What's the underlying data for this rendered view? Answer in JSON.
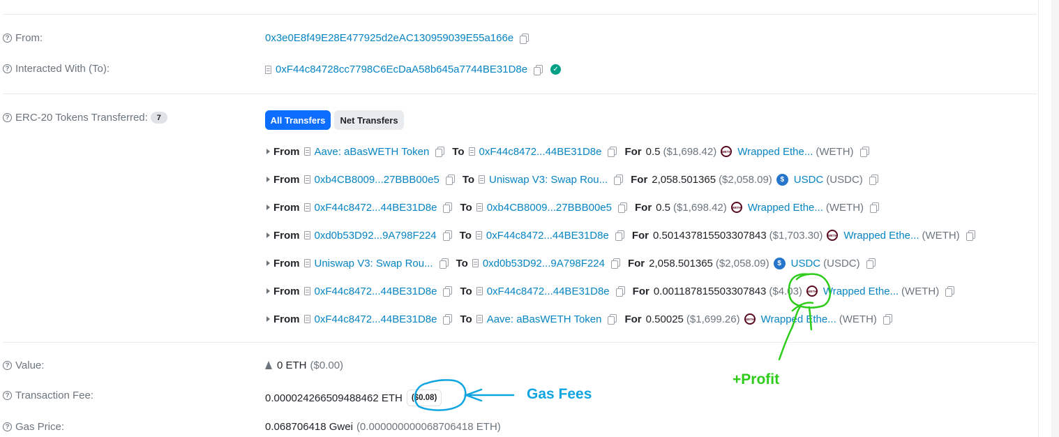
{
  "from": {
    "label": "From:",
    "address": "0x3e0E8f49E28E477925d2eAC130959039E55a166e"
  },
  "interacted": {
    "label": "Interacted With (To):",
    "address": "0xF44c84728cc7798C6EcDaA58b645a7744BE31D8e"
  },
  "erc20": {
    "label": "ERC-20 Tokens Transferred:",
    "count": "7",
    "tabs": {
      "all": "All Transfers",
      "net": "Net Transfers"
    },
    "rows": [
      {
        "from": "Aave: aBasWETH Token",
        "to": "0xF44c8472...44BE31D8e",
        "amount": "0.5",
        "usd": "($1,698.42)",
        "token": "Wrapped Ethe...",
        "symbol": "(WETH)",
        "icon": "weth"
      },
      {
        "from": "0xb4CB8009...27BBB00e5",
        "to": "Uniswap V3: Swap Rou...",
        "amount": "2,058.501365",
        "usd": "($2,058.09)",
        "token": "USDC",
        "symbol": "(USDC)",
        "icon": "usdc"
      },
      {
        "from": "0xF44c8472...44BE31D8e",
        "to": "0xb4CB8009...27BBB00e5",
        "amount": "0.5",
        "usd": "($1,698.42)",
        "token": "Wrapped Ethe...",
        "symbol": "(WETH)",
        "icon": "weth"
      },
      {
        "from": "0xd0b53D92...9A798F224",
        "to": "0xF44c8472...44BE31D8e",
        "amount": "0.501437815503307843",
        "usd": "($1,703.30)",
        "token": "Wrapped Ethe...",
        "symbol": "(WETH)",
        "icon": "weth"
      },
      {
        "from": "Uniswap V3: Swap Rou...",
        "to": "0xd0b53D92...9A798F224",
        "amount": "2,058.501365",
        "usd": "($2,058.09)",
        "token": "USDC",
        "symbol": "(USDC)",
        "icon": "usdc"
      },
      {
        "from": "0xF44c8472...44BE31D8e",
        "to": "0xF44c8472...44BE31D8e",
        "amount": "0.001187815503307843",
        "usd": "($4.03)",
        "token": "Wrapped Ethe...",
        "symbol": "(WETH)",
        "icon": "weth"
      },
      {
        "from": "0xF44c8472...44BE31D8e",
        "to": "Aave: aBasWETH Token",
        "amount": "0.50025",
        "usd": "($1,699.26)",
        "token": "Wrapped Ethe...",
        "symbol": "(WETH)",
        "icon": "weth"
      }
    ],
    "words": {
      "from": "From",
      "to": "To",
      "for": "For"
    }
  },
  "value": {
    "label": "Value:",
    "amount": "0 ETH",
    "usd": "($0.00)"
  },
  "fee": {
    "label": "Transaction Fee:",
    "amount": "0.000024266509488462 ETH",
    "usd": "($0.08)"
  },
  "gas": {
    "label": "Gas Price:",
    "amount": "0.068706418 Gwei",
    "eth": "(0.000000000068706418 ETH)"
  },
  "annotations": {
    "profit": "+Profit",
    "gas_fees": "Gas Fees",
    "profit_color": "#2ecc1a",
    "gas_color": "#0ea5e0"
  },
  "colors": {
    "link": "#0784c3",
    "primary": "#0d6efd"
  }
}
